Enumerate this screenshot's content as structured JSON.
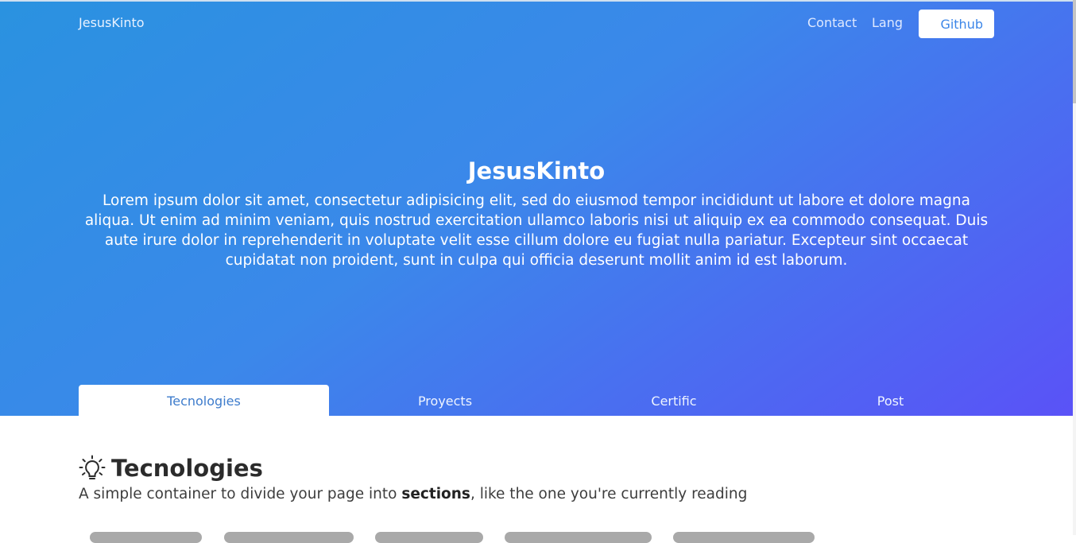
{
  "nav": {
    "brand": "JesusKinto",
    "contact": "Contact",
    "lang": "Lang",
    "github": "Github"
  },
  "hero": {
    "title": "JesusKinto",
    "text": "Lorem ipsum dolor sit amet, consectetur adipisicing elit, sed do eiusmod tempor incididunt ut labore et dolore magna aliqua. Ut enim ad minim veniam, quis nostrud exercitation ullamco laboris nisi ut aliquip ex ea commodo consequat. Duis aute irure dolor in reprehenderit in voluptate velit esse cillum dolore eu fugiat nulla pariatur. Excepteur sint occaecat cupidatat non proident, sunt in culpa qui officia deserunt mollit anim id est laborum."
  },
  "tabs": [
    {
      "label": "Tecnologies",
      "active": true
    },
    {
      "label": "Proyects",
      "active": false
    },
    {
      "label": "Certific",
      "active": false
    },
    {
      "label": "Post",
      "active": false
    }
  ],
  "section": {
    "icon": "lightbulb-icon",
    "title": "Tecnologies",
    "subtitle_before": "A simple container to divide your page into ",
    "subtitle_bold": "sections",
    "subtitle_after": ", like the one you're currently reading"
  },
  "colors": {
    "gradient_start": "#2a92e0",
    "gradient_end": "#5a52f7",
    "accent": "#3c86e8"
  }
}
